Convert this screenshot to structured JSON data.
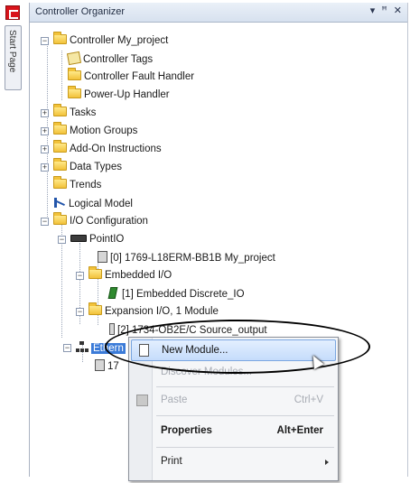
{
  "window": {
    "title": "Controller Organizer",
    "controls": [
      "▾",
      "ꟸ",
      "✕"
    ]
  },
  "side_tab": {
    "label": "Start Page"
  },
  "tree": {
    "items": [
      {
        "label": "Controller My_project",
        "icon": "folder-icon"
      },
      {
        "label": "Controller Tags",
        "icon": "tag-icon"
      },
      {
        "label": "Controller Fault Handler",
        "icon": "folder-icon"
      },
      {
        "label": "Power-Up Handler",
        "icon": "folder-icon"
      },
      {
        "label": "Tasks",
        "icon": "folder-icon"
      },
      {
        "label": "Motion Groups",
        "icon": "folder-icon"
      },
      {
        "label": "Add-On Instructions",
        "icon": "folder-icon"
      },
      {
        "label": "Data Types",
        "icon": "folder-icon"
      },
      {
        "label": "Trends",
        "icon": "folder-icon"
      },
      {
        "label": "Logical Model",
        "icon": "logic-icon"
      },
      {
        "label": "I/O Configuration",
        "icon": "folder-icon"
      },
      {
        "label": "PointIO",
        "icon": "rack-icon"
      },
      {
        "label": "[0] 1769-L18ERM-BB1B My_project",
        "icon": "module-icon"
      },
      {
        "label": "Embedded I/O",
        "icon": "folder-icon"
      },
      {
        "label": "[1] Embedded Discrete_IO",
        "icon": "green-module-icon"
      },
      {
        "label": "Expansion I/O, 1 Module",
        "icon": "folder-icon"
      },
      {
        "label": "[2] 1734-OB2E/C Source_output",
        "icon": "module-icon"
      },
      {
        "label": "Ethern",
        "icon": "network-icon"
      },
      {
        "label": "17",
        "icon": "module-icon"
      }
    ]
  },
  "context_menu": {
    "items": [
      {
        "label": "New Module...",
        "shortcut": "",
        "state": "highlighted"
      },
      {
        "label": "Discover Modules...",
        "shortcut": "",
        "state": "disabled"
      },
      {
        "label": "Paste",
        "shortcut": "Ctrl+V",
        "state": "disabled"
      },
      {
        "label": "Properties",
        "shortcut": "Alt+Enter",
        "state": "bold"
      },
      {
        "label": "Print",
        "shortcut": "",
        "state": "submenu"
      }
    ]
  }
}
